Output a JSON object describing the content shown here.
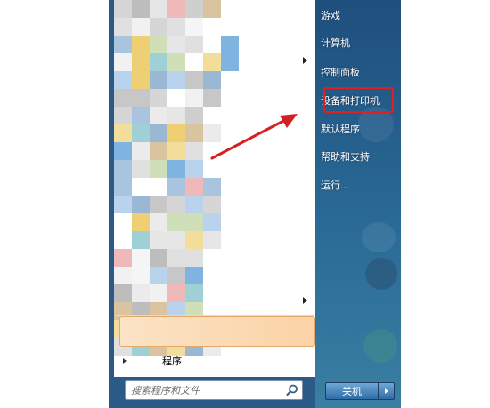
{
  "start_menu": {
    "right_items": [
      {
        "label": "游戏"
      },
      {
        "label": "计算机"
      },
      {
        "label": "控制面板"
      },
      {
        "label": "设备和打印机"
      },
      {
        "label": "默认程序"
      },
      {
        "label": "帮助和支持"
      },
      {
        "label": "运行..."
      }
    ],
    "highlighted_item": "设备和打印机",
    "all_programs_label": "程序",
    "search_placeholder": "搜索程序和文件",
    "shutdown_label": "关机"
  },
  "colors": {
    "highlight_box": "#e02020",
    "annotation_arrow": "#d42020",
    "right_panel": "#2a5a88"
  },
  "icons": {
    "search": "magnifier-icon",
    "shutdown_options": "triangle-right-icon"
  }
}
